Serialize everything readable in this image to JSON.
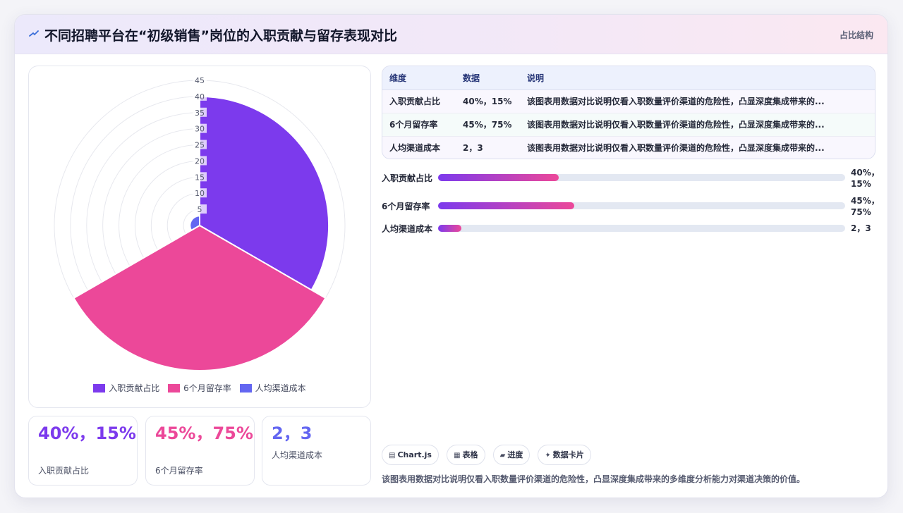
{
  "header": {
    "title_icon": "sparkle-icon",
    "title": "不同招聘平台在“初级销售”岗位的入职贡献与留存表现对比",
    "tag": "占比结构"
  },
  "colors": {
    "purple": "#7c3aed",
    "pink": "#ec4899",
    "indigo": "#6366f1"
  },
  "chart_data": {
    "type": "polarArea",
    "categories": [
      "入职贡献占比",
      "6个月留存率",
      "人均渠道成本"
    ],
    "values": [
      40,
      45,
      3
    ],
    "colors": [
      "#7c3aed",
      "#ec4899",
      "#6366f1"
    ],
    "r_axis": {
      "min": 0,
      "max": 45,
      "ticks": [
        "5",
        "10",
        "15",
        "20",
        "25",
        "30",
        "35",
        "40",
        "45"
      ]
    },
    "legend": "bottom"
  },
  "legend": [
    {
      "label": "入职贡献占比",
      "color": "#7c3aed"
    },
    {
      "label": "6个月留存率",
      "color": "#ec4899"
    },
    {
      "label": "人均渠道成本",
      "color": "#6366f1"
    }
  ],
  "stats": [
    {
      "value": "40%，15%",
      "label": "入职贡献占比",
      "color": "#7c3aed"
    },
    {
      "value": "45%，75%",
      "label": "6个月留存率",
      "color": "#ec4899"
    },
    {
      "value": "2，3",
      "label": "人均渠道成本",
      "color": "#6366f1"
    }
  ],
  "table": {
    "headers": [
      "维度",
      "数据",
      "说明"
    ],
    "rows": [
      [
        "入职贡献占比",
        "40%，15%",
        "该图表用数据对比说明仅看入职数量评价渠道的危险性，凸显深度集成带来的..."
      ],
      [
        "6个月留存率",
        "45%，75%",
        "该图表用数据对比说明仅看入职数量评价渠道的危险性，凸显深度集成带来的..."
      ],
      [
        "人均渠道成本",
        "2，3",
        "该图表用数据对比说明仅看入职数量评价渠道的危险性，凸显深度集成带来的..."
      ]
    ]
  },
  "progress": [
    {
      "label": "入职贡献占比",
      "value": "40%，15%",
      "fraction": 0.296
    },
    {
      "label": "6个月留存率",
      "value": "45%，75%",
      "fraction": 0.335
    },
    {
      "label": "人均渠道成本",
      "value": "2，3",
      "fraction": 0.058
    }
  ],
  "chips": [
    {
      "icon": "▤",
      "icon_name": "chartjs-icon",
      "label": "Chart.js"
    },
    {
      "icon": "▦",
      "icon_name": "table-icon",
      "label": "表格"
    },
    {
      "icon": "▰",
      "icon_name": "progress-icon",
      "label": "进度"
    },
    {
      "icon": "✦",
      "icon_name": "sparkle-icon",
      "label": "数据卡片"
    }
  ],
  "note": "该图表用数据对比说明仅看入职数量评价渠道的危险性，凸显深度集成带来的多维度分析能力对渠道决策的价值。"
}
